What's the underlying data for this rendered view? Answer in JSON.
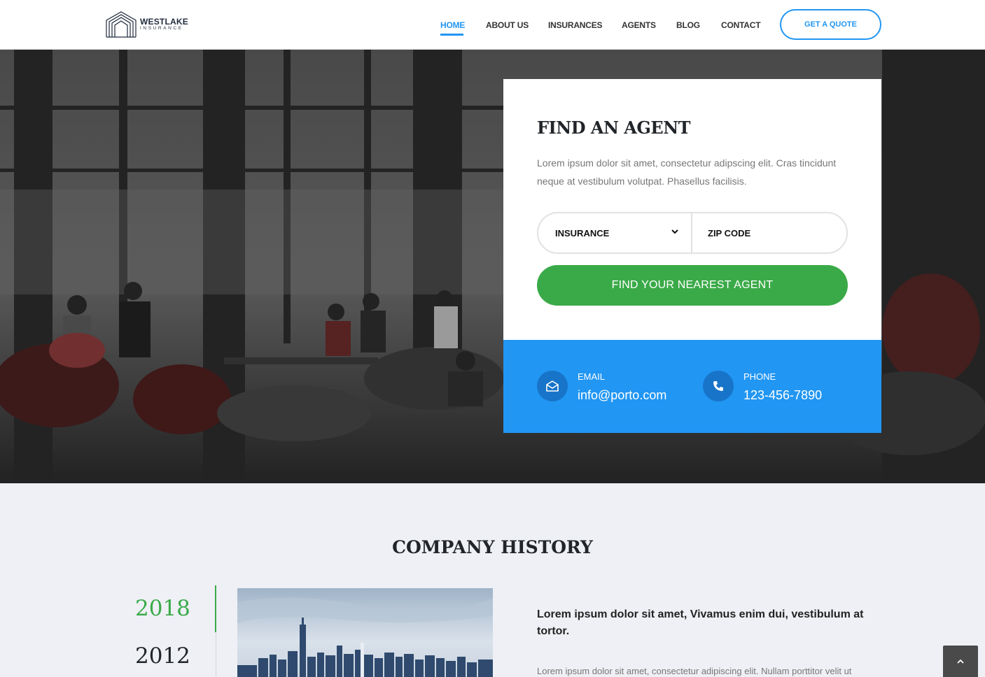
{
  "header": {
    "logo": {
      "name": "WESTLAKE",
      "sub": "INSURANCE"
    },
    "nav": [
      {
        "label": "HOME",
        "active": true
      },
      {
        "label": "ABOUT US",
        "active": false
      },
      {
        "label": "INSURANCES",
        "active": false
      },
      {
        "label": "AGENTS",
        "active": false
      },
      {
        "label": "BLOG",
        "active": false
      },
      {
        "label": "CONTACT",
        "active": false
      }
    ],
    "quote_button": "GET A QUOTE"
  },
  "agent_card": {
    "title": "FIND AN AGENT",
    "description": "Lorem ipsum dolor sit amet, consectetur adipscing elit. Cras tincidunt neque at vestibulum volutpat. Phasellus facilisis.",
    "select_value": "INSURANCE",
    "zip_placeholder": "ZIP CODE",
    "submit_label": "FIND YOUR NEAREST AGENT"
  },
  "contact": {
    "email_label": "EMAIL",
    "email_value": "info@porto.com",
    "phone_label": "PHONE",
    "phone_value": "123-456-7890"
  },
  "history": {
    "title": "COMPANY HISTORY",
    "years": [
      "2018",
      "2012"
    ],
    "active_year": "2018",
    "heading": "Lorem ipsum dolor sit amet, Vivamus enim dui, vestibulum at tortor.",
    "text": "Lorem ipsum dolor sit amet, consectetur adipiscing elit. Nullam porttitor velit ut"
  },
  "colors": {
    "primary": "#2196f3",
    "green": "#3aaa48",
    "dark_text": "#212529"
  },
  "icons": {
    "email": "envelope-open-icon",
    "phone": "phone-icon",
    "scroll_top": "chevron-up-icon",
    "select": "chevron-down-icon"
  }
}
